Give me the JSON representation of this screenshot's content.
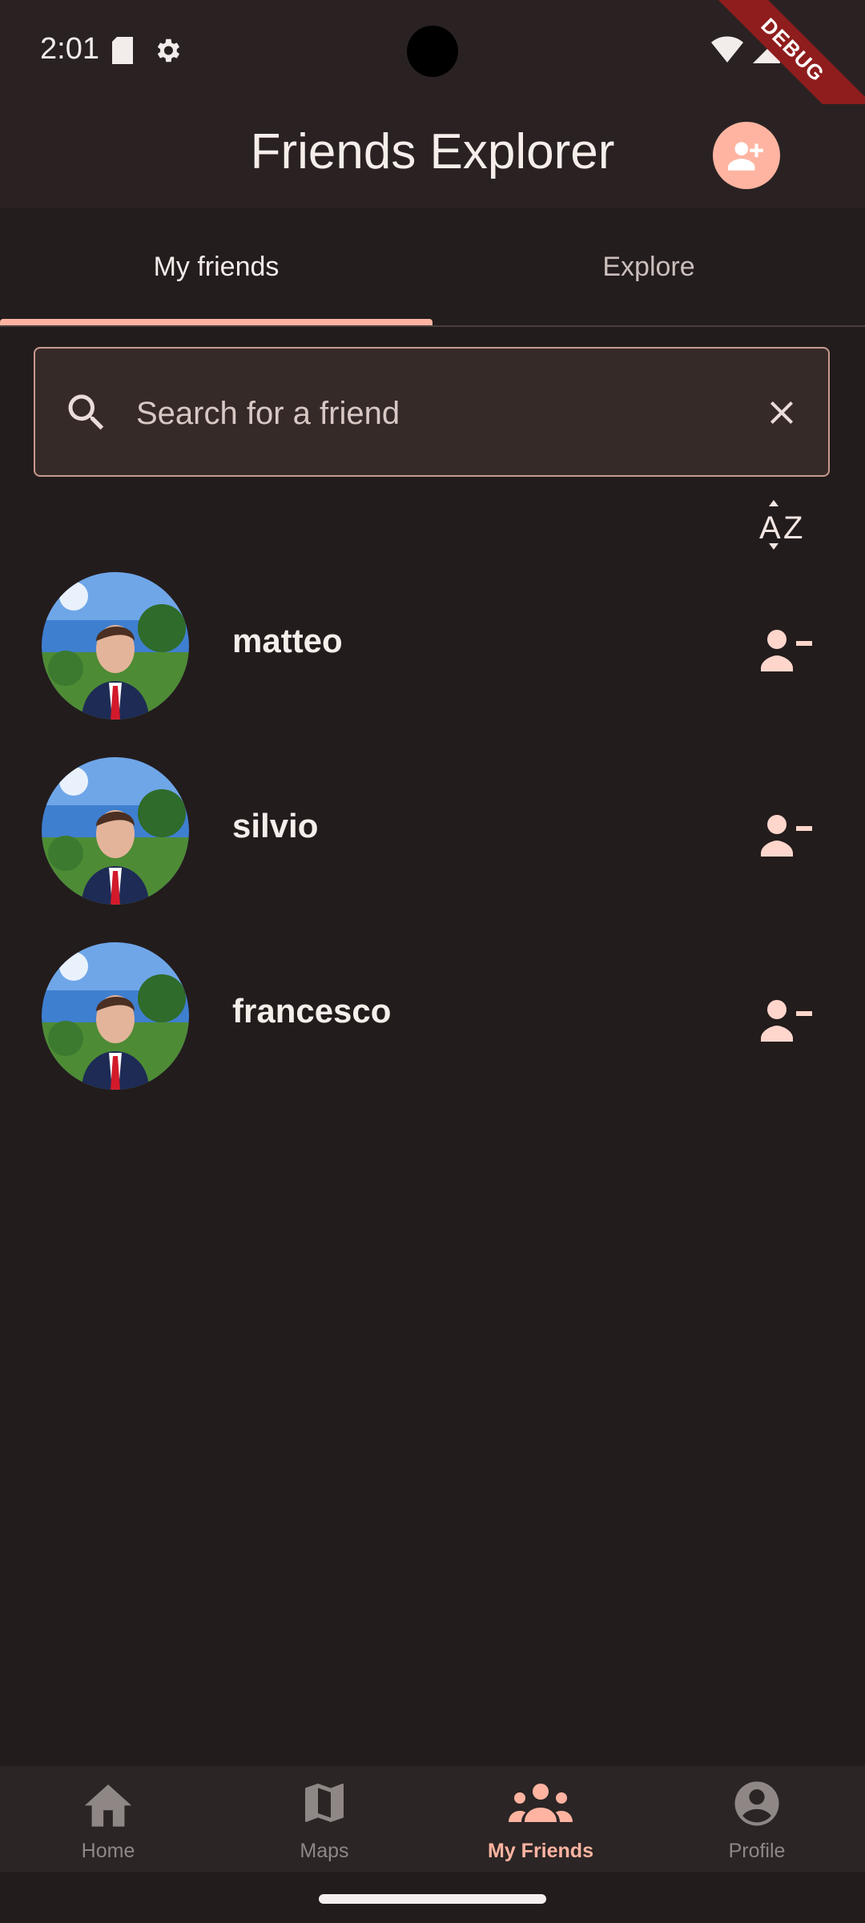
{
  "status_bar": {
    "time": "2:01",
    "debug_label": "DEBUG"
  },
  "app_bar": {
    "title": "Friends Explorer",
    "add_friend_icon": "person-add-icon"
  },
  "tabs": [
    {
      "label": "My friends",
      "active": true
    },
    {
      "label": "Explore",
      "active": false
    }
  ],
  "search": {
    "placeholder": "Search for a friend",
    "value": ""
  },
  "sort": {
    "icon": "sort-az-icon"
  },
  "friends": [
    {
      "name": "matteo"
    },
    {
      "name": "silvio"
    },
    {
      "name": "francesco"
    }
  ],
  "bottom_nav": [
    {
      "label": "Home",
      "icon": "home-icon",
      "active": false
    },
    {
      "label": "Maps",
      "icon": "map-icon",
      "active": false
    },
    {
      "label": "My Friends",
      "icon": "groups-icon",
      "active": true
    },
    {
      "label": "Profile",
      "icon": "account-circle-icon",
      "active": false
    }
  ],
  "colors": {
    "background": "#231c1c",
    "accent": "#ffb4a1",
    "inactive_nav": "#8f8785"
  }
}
